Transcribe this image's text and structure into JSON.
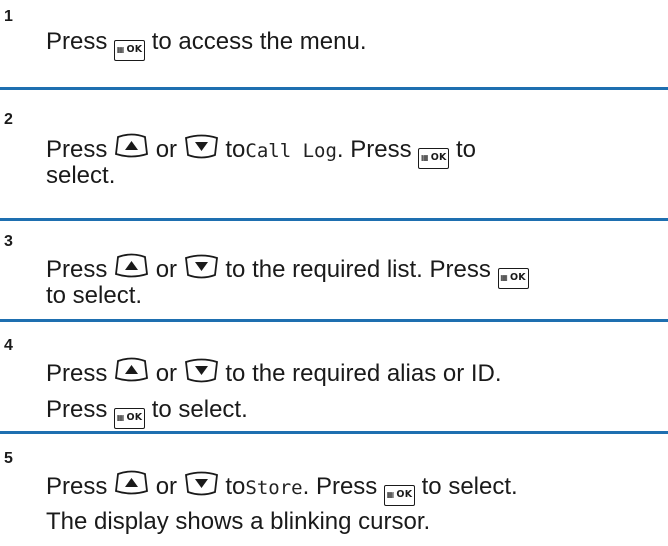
{
  "steps": [
    {
      "number": "1",
      "lines": [
        [
          "Press",
          "ok-key",
          "to access the menu."
        ]
      ]
    },
    {
      "number": "2",
      "lines": [
        [
          "Press",
          "up-key",
          "or",
          "down-key",
          "to",
          "Call Log",
          ". Press",
          "ok-key",
          "to"
        ],
        [
          "select."
        ]
      ]
    },
    {
      "number": "3",
      "lines": [
        [
          "Press",
          "up-key",
          "or",
          "down-key",
          "to the required list. Press",
          "ok-key"
        ],
        [
          "to select."
        ]
      ]
    },
    {
      "number": "4",
      "lines": [
        [
          "Press",
          "up-key",
          "or",
          "down-key",
          "to the required alias or ID."
        ],
        [
          "Press",
          "ok-key",
          "to select."
        ]
      ]
    },
    {
      "number": "5",
      "lines": [
        [
          "Press",
          "up-key",
          "or",
          "down-key",
          "to",
          "Store",
          ". Press",
          "ok-key",
          "to select."
        ],
        [
          "The display shows a blinking cursor."
        ]
      ]
    }
  ],
  "text": {
    "s1_num": "1",
    "s1_l1a": "Press",
    "s1_l1b": "to access the menu.",
    "s2_num": "2",
    "s2_press": "Press",
    "s2_or": "or",
    "s2_to": "to",
    "s2_menu": "Call Log",
    "s2_press2": ". Press",
    "s2_to2": "to",
    "s2_select": "select.",
    "s3_num": "3",
    "s3_press": "Press",
    "s3_or": "or",
    "s3_mid": "to the required list. Press",
    "s3_l2": "to select.",
    "s4_num": "4",
    "s4_press": "Press",
    "s4_or": "or",
    "s4_mid": "to the required alias or ID.",
    "s4_press2": "Press",
    "s4_end": "to select.",
    "s5_num": "5",
    "s5_press": "Press",
    "s5_or": "or",
    "s5_to": "to",
    "s5_menu": "Store",
    "s5_press2": ". Press",
    "s5_end": "to select.",
    "s5_l2": "The display shows a blinking cursor."
  },
  "ok_key": {
    "grid_glyph": "▦",
    "label": "OK"
  },
  "icons": {
    "ok": "menu-ok-key-icon",
    "up": "up-navigation-key-icon",
    "down": "down-navigation-key-icon"
  },
  "colors": {
    "divider": "#1e6fb0",
    "text": "#1a1a1a"
  }
}
